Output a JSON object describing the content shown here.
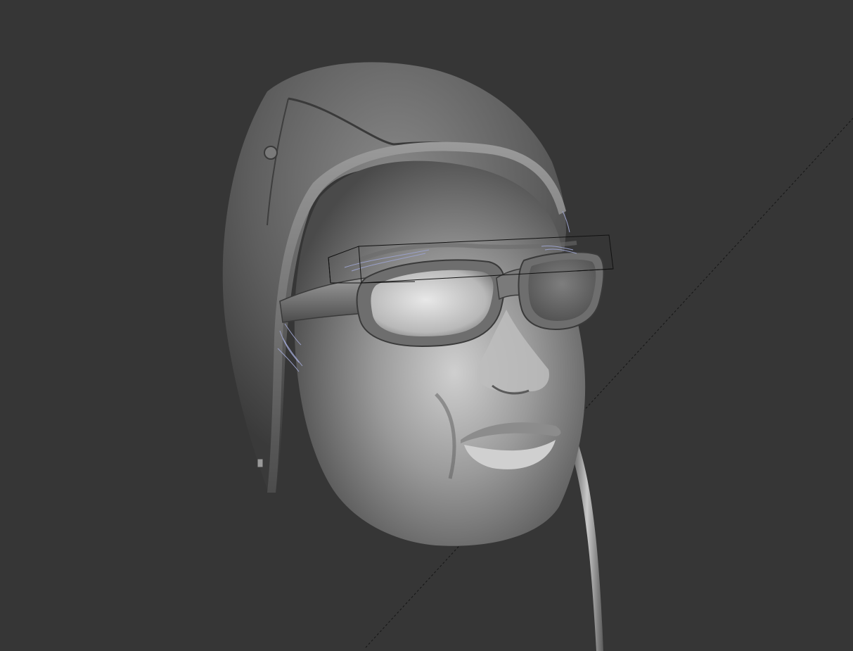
{
  "viewport": {
    "background_color": "#363636",
    "model": "sculpted-head-with-aviator-cap-and-goggles",
    "material_color": "#8a8a8a",
    "selection_gizmo": "bounding-box",
    "gizmo_color": "#111111",
    "guide_line": "dashed-diagonal",
    "hair_strand_color": "#9aa0c8"
  }
}
